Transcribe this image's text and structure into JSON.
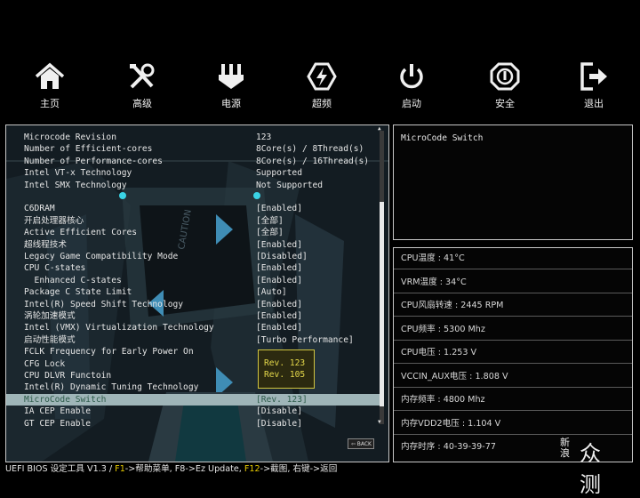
{
  "nav": {
    "items": [
      {
        "label": "主页",
        "icon": "home-icon"
      },
      {
        "label": "高级",
        "icon": "tools-icon"
      },
      {
        "label": "电源",
        "icon": "power-supply-icon"
      },
      {
        "label": "超频",
        "icon": "overclock-lightning-icon"
      },
      {
        "label": "启动",
        "icon": "power-button-icon"
      },
      {
        "label": "安全",
        "icon": "security-badge-icon"
      },
      {
        "label": "退出",
        "icon": "exit-icon"
      }
    ]
  },
  "settings": [
    {
      "label": "Microcode Revision",
      "value": "123"
    },
    {
      "label": "Number of Efficient-cores",
      "value": "8Core(s) / 8Thread(s)"
    },
    {
      "label": "Number of Performance-cores",
      "value": "8Core(s) / 16Thread(s)"
    },
    {
      "label": "Intel VT-x Technology",
      "value": "Supported"
    },
    {
      "label": "Intel SMX Technology",
      "value": "Not Supported"
    },
    {
      "label": "",
      "value": ""
    },
    {
      "label": "C6DRAM",
      "value": "[Enabled]"
    },
    {
      "label": "开启处理器核心",
      "value": "[全部]"
    },
    {
      "label": "Active Efficient Cores",
      "value": "[全部]"
    },
    {
      "label": "超线程技术",
      "value": "[Enabled]"
    },
    {
      "label": "Legacy Game Compatibility Mode",
      "value": "[Disabled]"
    },
    {
      "label": "CPU C-states",
      "value": "[Enabled]"
    },
    {
      "label": "  Enhanced C-states",
      "value": "[Enabled]"
    },
    {
      "label": "Package C State Limit",
      "value": "[Auto]"
    },
    {
      "label": "Intel(R) Speed Shift Technology",
      "value": "[Enabled]"
    },
    {
      "label": "涡轮加速模式",
      "value": "[Enabled]"
    },
    {
      "label": "Intel (VMX) Virtualization Technology",
      "value": "[Enabled]"
    },
    {
      "label": "启动性能模式",
      "value": "[Turbo Performance]"
    },
    {
      "label": "FCLK Frequency for Early Power On",
      "value": ""
    },
    {
      "label": "CFG Lock",
      "value": ""
    },
    {
      "label": "CPU DLVR Functoin",
      "value": ""
    },
    {
      "label": "Intel(R) Dynamic Tuning Technology",
      "value": ""
    },
    {
      "label": "MicroCode Switch",
      "value": "[Rev. 123]"
    },
    {
      "label": "IA CEP Enable",
      "value": "[Disable]"
    },
    {
      "label": "GT CEP Enable",
      "value": "[Disable]"
    }
  ],
  "selected_index": 22,
  "popup": {
    "options": [
      "Rev. 123",
      "Rev. 105"
    ]
  },
  "back_label": "BACK",
  "help_text": "MicroCode Switch",
  "stats": [
    {
      "label": "CPU温度",
      "value": "41°C"
    },
    {
      "label": "VRM温度",
      "value": "34°C"
    },
    {
      "label": "CPU风扇转速",
      "value": "2445 RPM"
    },
    {
      "label": "CPU频率",
      "value": "5300 Mhz"
    },
    {
      "label": "CPU电压",
      "value": "1.253 V"
    },
    {
      "label": "VCCIN_AUX电压",
      "value": "1.808 V"
    },
    {
      "label": "内存频率",
      "value": "4800 Mhz"
    },
    {
      "label": "内存VDD2电压",
      "value": "1.104 V"
    },
    {
      "label": "内存时序",
      "value": "40-39-39-77"
    }
  ],
  "footer": {
    "prefix": "UEFI BIOS 设定工具 V1.3 / ",
    "f1": "F1",
    "help": "->帮助菜单, F8->Ez Update, ",
    "f12": "F12",
    "rest": "->截图, 右键->返回"
  },
  "watermark": {
    "small": "新浪",
    "big": "众测"
  },
  "colors": {
    "accent": "#e6c900",
    "selected_row": "#9fb5b8",
    "popup_border": "#d2c640"
  }
}
